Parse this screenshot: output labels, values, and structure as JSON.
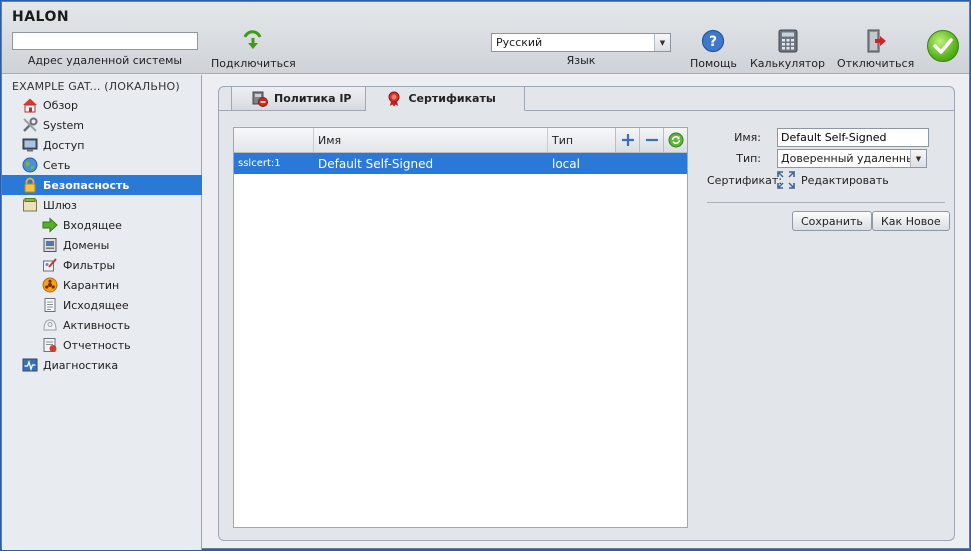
{
  "app": {
    "logo": "HALON"
  },
  "toolbar": {
    "address_value": "",
    "address_label": "Адрес удаленной системы",
    "connect_label": "Подключиться",
    "language_value": "Русский",
    "language_label": "Язык",
    "help_label": "Помощь",
    "calculator_label": "Калькулятор",
    "disconnect_label": "Отключиться"
  },
  "sidebar": {
    "title": "EXAMPLE GAT... (ЛОКАЛЬНО)",
    "items": [
      {
        "label": "Обзор",
        "icon": "home-icon",
        "level": 1
      },
      {
        "label": "System",
        "icon": "tools-icon",
        "level": 1
      },
      {
        "label": "Доступ",
        "icon": "monitor-icon",
        "level": 1
      },
      {
        "label": "Сеть",
        "icon": "globe-icon",
        "level": 1
      },
      {
        "label": "Безопасность",
        "icon": "lock-icon",
        "level": 1,
        "active": true
      },
      {
        "label": "Шлюз",
        "icon": "gateway-icon",
        "level": 1
      },
      {
        "label": "Входящее",
        "icon": "arrow-right-icon",
        "level": 2
      },
      {
        "label": "Домены",
        "icon": "domains-icon",
        "level": 2
      },
      {
        "label": "Фильтры",
        "icon": "filters-icon",
        "level": 2
      },
      {
        "label": "Карантин",
        "icon": "biohazard-icon",
        "level": 2
      },
      {
        "label": "Исходящее",
        "icon": "document-icon",
        "level": 2
      },
      {
        "label": "Активность",
        "icon": "activity-icon",
        "level": 2
      },
      {
        "label": "Отчетность",
        "icon": "report-icon",
        "level": 2
      },
      {
        "label": "Диагностика",
        "icon": "diagnostics-icon",
        "level": 1
      }
    ]
  },
  "tabs": [
    {
      "label": "Политика IP",
      "icon": "ip-policy-icon",
      "selected": false
    },
    {
      "label": "Сертификаты",
      "icon": "certificate-icon",
      "selected": true
    }
  ],
  "list": {
    "columns": [
      "",
      "Имя",
      "Тип"
    ],
    "rows": [
      {
        "id": "sslcert:1",
        "name": "Default Self-Signed",
        "type": "local"
      }
    ]
  },
  "form": {
    "name_label": "Имя:",
    "name_value": "Default Self-Signed",
    "type_label": "Тип:",
    "type_value": "Доверенный удаленный",
    "cert_label": "Сертификат:",
    "edit_label": "Редактировать",
    "save_label": "Сохранить",
    "save_as_new_label": "Как Новое"
  },
  "colors": {
    "accent": "#2a79d6",
    "sidebar_bg": "#e8ebef",
    "panel_bg": "#e2e5e9"
  }
}
